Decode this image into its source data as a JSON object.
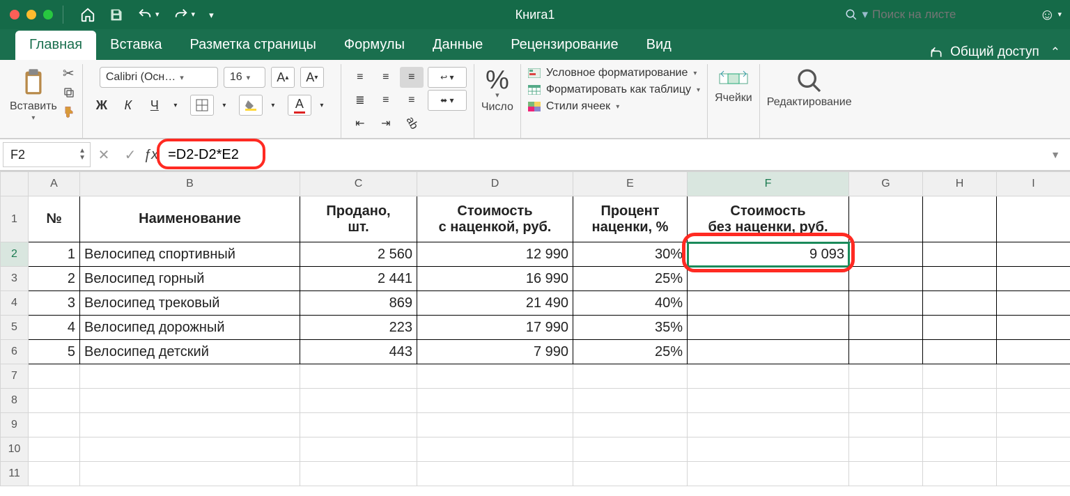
{
  "title": "Книга1",
  "search_placeholder": "Поиск на листе",
  "tabs": {
    "home": "Главная",
    "insert": "Вставка",
    "layout": "Разметка страницы",
    "formulas": "Формулы",
    "data": "Данные",
    "review": "Рецензирование",
    "view": "Вид"
  },
  "share_label": "Общий доступ",
  "ribbon": {
    "paste": "Вставить",
    "font_name": "Calibri (Осн…",
    "font_size": "16",
    "number": "Число",
    "cond_fmt": "Условное форматирование",
    "as_table": "Форматировать как таблицу",
    "cell_styles": "Стили ячеек",
    "cells": "Ячейки",
    "editing": "Редактирование"
  },
  "namebox": "F2",
  "formula": "=D2-D2*E2",
  "columns": [
    "",
    "A",
    "B",
    "C",
    "D",
    "E",
    "F",
    "G",
    "H",
    "I"
  ],
  "headers": {
    "num": "№",
    "name": "Наименование",
    "sold_l1": "Продано,",
    "sold_l2": "шт.",
    "price_l1": "Стоимость",
    "price_l2": "с наценкой, руб.",
    "markup_l1": "Процент",
    "markup_l2": "наценки, %",
    "nosur_l1": "Стоимость",
    "nosur_l2": "без наценки, руб."
  },
  "rows": [
    {
      "n": "1",
      "name": "Велосипед спортивный",
      "sold": "2 560",
      "price": "12 990",
      "markup": "30%",
      "nosur": "9 093"
    },
    {
      "n": "2",
      "name": "Велосипед горный",
      "sold": "2 441",
      "price": "16 990",
      "markup": "25%",
      "nosur": ""
    },
    {
      "n": "3",
      "name": "Велосипед трековый",
      "sold": "869",
      "price": "21 490",
      "markup": "40%",
      "nosur": ""
    },
    {
      "n": "4",
      "name": "Велосипед дорожный",
      "sold": "223",
      "price": "17 990",
      "markup": "35%",
      "nosur": ""
    },
    {
      "n": "5",
      "name": "Велосипед детский",
      "sold": "443",
      "price": "7 990",
      "markup": "25%",
      "nosur": ""
    }
  ],
  "row_labels": [
    "1",
    "2",
    "3",
    "4",
    "5",
    "6",
    "7",
    "8",
    "9",
    "10",
    "11"
  ],
  "chart_data": {
    "type": "table",
    "columns": [
      "№",
      "Наименование",
      "Продано, шт.",
      "Стоимость с наценкой, руб.",
      "Процент наценки, %",
      "Стоимость без наценки, руб."
    ],
    "rows": [
      [
        1,
        "Велосипед спортивный",
        2560,
        12990,
        0.3,
        9093
      ],
      [
        2,
        "Велосипед горный",
        2441,
        16990,
        0.25,
        null
      ],
      [
        3,
        "Велосипед трековый",
        869,
        21490,
        0.4,
        null
      ],
      [
        4,
        "Велосипед дорожный",
        223,
        17990,
        0.35,
        null
      ],
      [
        5,
        "Велосипед детский",
        443,
        7990,
        0.25,
        null
      ]
    ],
    "formula_F2": "=D2-D2*E2"
  }
}
